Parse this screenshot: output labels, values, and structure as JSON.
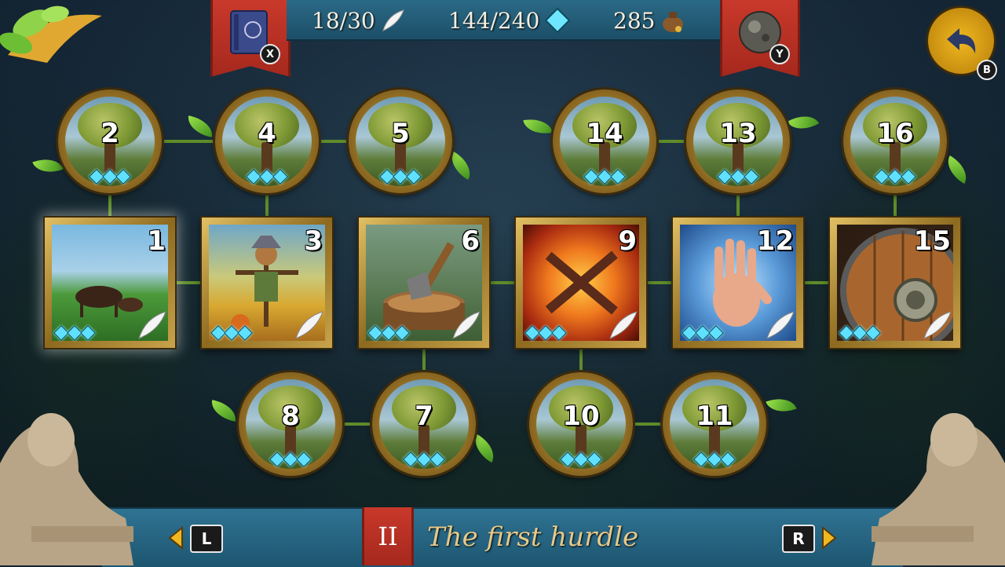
{
  "top_bar": {
    "feathers": "18/30",
    "gems": "144/240",
    "coins": "285"
  },
  "buttons": {
    "journal_key": "X",
    "orb_key": "Y",
    "back_key": "B",
    "prev_key": "L",
    "next_key": "R"
  },
  "tree_nodes": [
    {
      "id": "node-2",
      "number": "2"
    },
    {
      "id": "node-4",
      "number": "4"
    },
    {
      "id": "node-5",
      "number": "5"
    },
    {
      "id": "node-14",
      "number": "14"
    },
    {
      "id": "node-13",
      "number": "13"
    },
    {
      "id": "node-16",
      "number": "16"
    },
    {
      "id": "node-8",
      "number": "8"
    },
    {
      "id": "node-7",
      "number": "7"
    },
    {
      "id": "node-10",
      "number": "10"
    },
    {
      "id": "node-11",
      "number": "11"
    }
  ],
  "level_nodes": [
    {
      "number": "1",
      "art": "horses-pasture"
    },
    {
      "number": "3",
      "art": "scarecrow-field"
    },
    {
      "number": "6",
      "art": "axe-in-stump"
    },
    {
      "number": "9",
      "art": "crossed-swords-fire"
    },
    {
      "number": "12",
      "art": "magic-hand"
    },
    {
      "number": "15",
      "art": "wooden-shield"
    }
  ],
  "chapter": {
    "numeral": "II",
    "title": "The first hurdle"
  },
  "colors": {
    "accent_red": "#c8392b",
    "bar_blue": "#2b6a86",
    "gold": "#d8b055",
    "gem_cyan": "#5fe0ff"
  }
}
